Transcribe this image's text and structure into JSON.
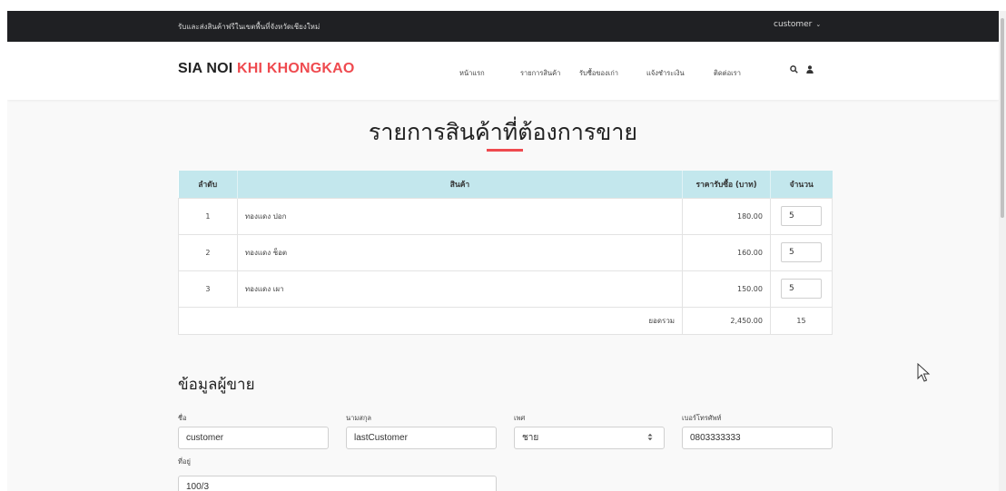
{
  "topbar": {
    "announcement": "รับและส่งสินค้าฟรีในเขตพื้นที่จังหวัดเชียงใหม่",
    "user_menu": "customer",
    "user_menu_chevron": "⌄"
  },
  "header": {
    "logo_part1": "SIA NOI ",
    "logo_part2": "KHI KHONGKAO",
    "nav": [
      "หน้าแรก",
      "รายการสินค้า",
      "รับซื้อของเก่า",
      "แจ้งชำระเงิน",
      "ติดต่อเรา"
    ],
    "search_icon": "search-icon",
    "user_icon": "user-icon"
  },
  "page_title": "รายการสินค้าที่ต้องการขาย",
  "table": {
    "headers": [
      "ลำดับ",
      "สินค้า",
      "ราคารับซื้อ (บาท)",
      "จำนวน"
    ],
    "rows": [
      {
        "no": "1",
        "product": "ทองแดง ปอก",
        "price": "180.00",
        "qty": "5"
      },
      {
        "no": "2",
        "product": "ทองแดง ช็อต",
        "price": "160.00",
        "qty": "5"
      },
      {
        "no": "3",
        "product": "ทองแดง เผา",
        "price": "150.00",
        "qty": "5"
      }
    ],
    "total_label": "ยอดรวม",
    "total_price": "2,450.00",
    "total_qty": "15"
  },
  "seller": {
    "section_title": "ข้อมูลผู้ขาย",
    "first_name_label": "ชื่อ",
    "first_name_value": "customer",
    "last_name_label": "นามสกุล",
    "last_name_value": "lastCustomer",
    "gender_label": "เพศ",
    "gender_value": "ชาย",
    "phone_label": "เบอร์โทรศัพท์",
    "phone_value": "0803333333",
    "address_label": "ที่อยู่",
    "address_value": "100/3"
  },
  "colors": {
    "accent": "#ef4a4f",
    "topbar_bg": "#1f2023",
    "table_header_bg": "#c3e7ed"
  }
}
